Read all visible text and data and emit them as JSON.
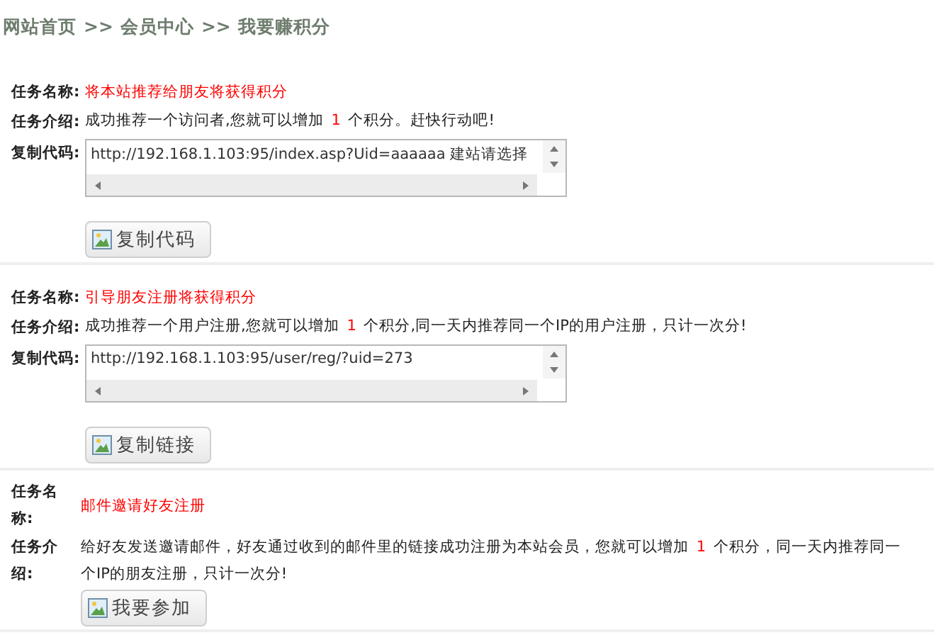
{
  "breadcrumb": [
    "网站首页",
    ">>",
    "会员中心",
    ">>",
    "我要赚积分"
  ],
  "tasks": [
    {
      "kind": "code",
      "name_label": "任务名称:",
      "name": "将本站推荐给朋友将获得积分",
      "intro_label": "任务介绍:",
      "intro": [
        {
          "kind": "plain",
          "text": "成功推荐一个访问者,您就可以增加 "
        },
        {
          "kind": "points",
          "text": "1"
        },
        {
          "kind": "plain",
          "text": " 个积分。赶快行动吧!"
        }
      ],
      "code_label": "复制代码:",
      "code": "http://192.168.1.103:95/index.asp?Uid=aaaaaa 建站请选择",
      "button": "复制代码"
    },
    {
      "kind": "code",
      "name_label": "任务名称:",
      "name": "引导朋友注册将获得积分",
      "intro_label": "任务介绍:",
      "intro": [
        {
          "kind": "plain",
          "text": "成功推荐一个用户注册,您就可以增加 "
        },
        {
          "kind": "points",
          "text": "1"
        },
        {
          "kind": "plain",
          "text": " 个积分,同一天内推荐同一个IP的用户注册，只计一次分!"
        }
      ],
      "code_label": "复制代码:",
      "code": "http://192.168.1.103:95/user/reg/?uid=273",
      "button": "复制链接"
    },
    {
      "kind": "invite",
      "name_label": "任务名称:",
      "name": "邮件邀请好友注册",
      "intro_label": "任务介绍:",
      "intro": [
        {
          "kind": "plain",
          "text": "给好友发送邀请邮件，好友通过收到的邮件里的链接成功注册为本站会员，您就可以增加 "
        },
        {
          "kind": "points",
          "text": "1"
        },
        {
          "kind": "plain",
          "text": " 个积分，同一天内推荐同一个IP的朋友注册，只计一次分!"
        }
      ],
      "button": "我要参加"
    }
  ]
}
